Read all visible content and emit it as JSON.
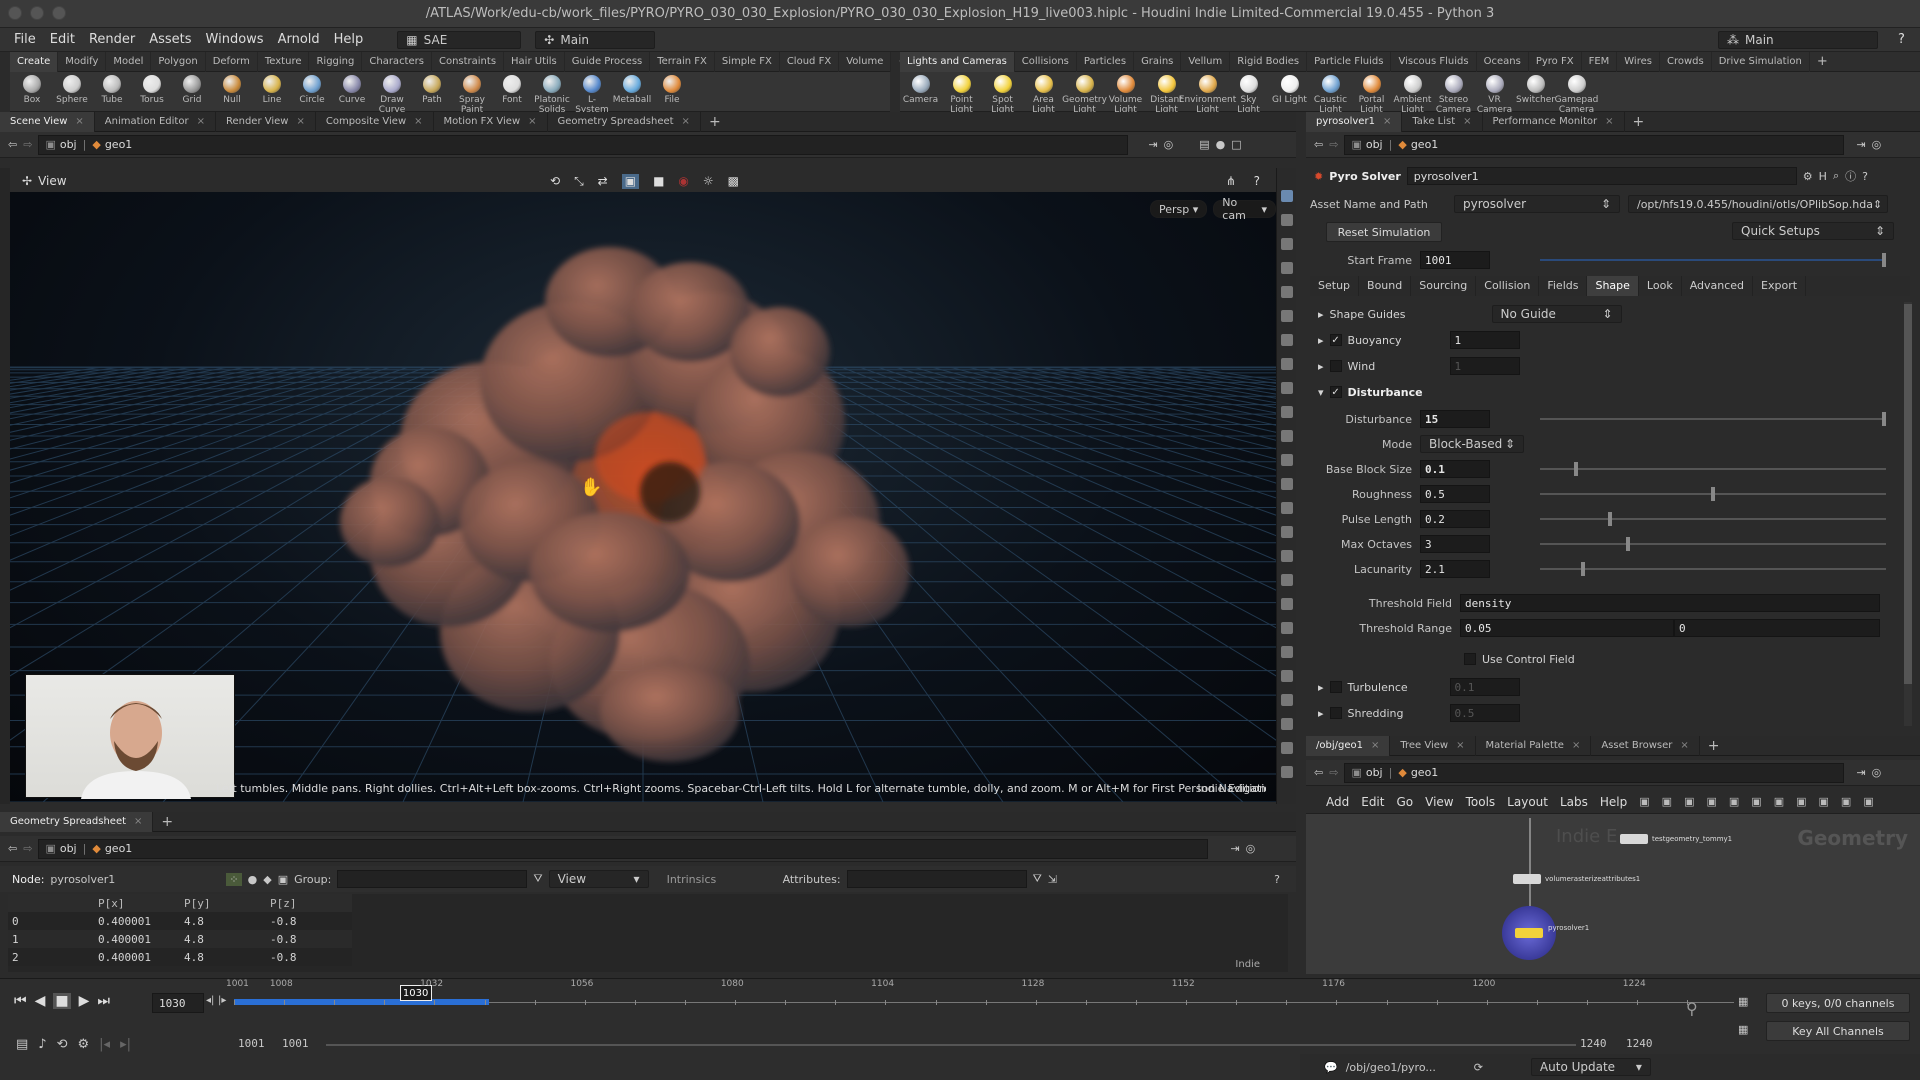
{
  "window": {
    "title": "/ATLAS/Work/edu-cb/work_files/PYRO/PYRO_030_030_Explosion/PYRO_030_030_Explosion_H19_live003.hiplc - Houdini Indie Limited-Commercial 19.0.455 - Python 3",
    "desktop_left": "SAE",
    "desktop_mid": "Main",
    "desktop_right": "Main"
  },
  "menu": [
    "File",
    "Edit",
    "Render",
    "Assets",
    "Windows",
    "Arnold",
    "Help"
  ],
  "shelf_left": {
    "tabs": [
      "Create",
      "Modify",
      "Model",
      "Polygon",
      "Deform",
      "Texture",
      "Rigging",
      "Characters",
      "Constraints",
      "Hair Utils",
      "Guide Process",
      "Terrain FX",
      "Simple FX",
      "Cloud FX",
      "Volume"
    ],
    "tools": [
      "Box",
      "Sphere",
      "Tube",
      "Torus",
      "Grid",
      "Null",
      "Line",
      "Circle",
      "Curve",
      "Draw Curve",
      "Path",
      "Spray Paint",
      "Font",
      "Platonic Solids",
      "L-System",
      "Metaball",
      "File"
    ]
  },
  "shelf_right": {
    "tabs": [
      "Lights and Cameras",
      "Collisions",
      "Particles",
      "Grains",
      "Vellum",
      "Rigid Bodies",
      "Particle Fluids",
      "Viscous Fluids",
      "Oceans",
      "Pyro FX",
      "FEM",
      "Wires",
      "Crowds",
      "Drive Simulation"
    ],
    "tools": [
      "Camera",
      "Point Light",
      "Spot Light",
      "Area Light",
      "Geometry Light",
      "Volume Light",
      "Distant Light",
      "Environment Light",
      "Sky Light",
      "GI Light",
      "Caustic Light",
      "Portal Light",
      "Ambient Light",
      "Stereo Camera",
      "VR Camera",
      "Switcher",
      "Gamepad Camera"
    ]
  },
  "left_pane": {
    "tabs": [
      "Scene View",
      "Animation Editor",
      "Render View",
      "Composite View",
      "Motion FX View",
      "Geometry Spreadsheet"
    ],
    "path_obj": "obj",
    "path_geo": "geo1",
    "view_label": "View",
    "persp": "Persp",
    "cam": "No cam",
    "help_text": "Left tumbles. Middle pans. Right dollies. Ctrl+Alt+Left box-zooms. Ctrl+Right zooms. Spacebar-Ctrl-Left tilts. Hold L for alternate tumble, dolly, and zoom.     M or Alt+M for First Person Navigation.",
    "edition": "Indie Edition"
  },
  "spreadsheet": {
    "tab": "Geometry Spreadsheet",
    "path_obj": "obj",
    "path_geo": "geo1",
    "node_label": "Node:",
    "node": "pyrosolver1",
    "group_label": "Group:",
    "view": "View",
    "intrinsics": "Intrinsics",
    "attributes_label": "Attributes:",
    "columns": [
      "",
      "P[x]",
      "P[y]",
      "P[z]"
    ],
    "rows": [
      [
        "0",
        "0.400001",
        "4.8",
        "-0.8"
      ],
      [
        "1",
        "0.400001",
        "4.8",
        "-0.8"
      ],
      [
        "2",
        "0.400001",
        "4.8",
        "-0.8"
      ]
    ],
    "indie": "Indie"
  },
  "params": {
    "tabs": [
      "pyrosolver1",
      "Take List",
      "Performance Monitor"
    ],
    "path_obj": "obj",
    "path_geo": "geo1",
    "node_type": "Pyro Solver",
    "node_name": "pyrosolver1",
    "asset_label": "Asset Name and Path",
    "asset_name": "pyrosolver",
    "asset_path": "/opt/hfs19.0.455/houdini/otls/OPlibSop.hda",
    "reset": "Reset Simulation",
    "quick": "Quick Setups",
    "start_label": "Start Frame",
    "start_value": "1001",
    "subtabs": [
      "Setup",
      "Bound",
      "Sourcing",
      "Collision",
      "Fields",
      "Shape",
      "Look",
      "Advanced",
      "Export"
    ],
    "shape_guides_label": "Shape Guides",
    "shape_guides_value": "No Guide",
    "buoyancy_label": "Buoyancy",
    "buoyancy_value": "1",
    "wind_label": "Wind",
    "wind_value": "1",
    "disturbance_section": "Disturbance",
    "rows": [
      {
        "label": "Disturbance",
        "value": "15",
        "level": 1.0
      },
      {
        "label": "Mode",
        "value": "Block-Based"
      },
      {
        "label": "Base Block Size",
        "value": "0.1",
        "level": 0.1
      },
      {
        "label": "Roughness",
        "value": "0.5",
        "level": 0.5
      },
      {
        "label": "Pulse Length",
        "value": "0.2",
        "level": 0.2
      },
      {
        "label": "Max Octaves",
        "value": "3",
        "level": 0.25
      },
      {
        "label": "Lacunarity",
        "value": "2.1",
        "level": 0.12
      }
    ],
    "threshold_field_label": "Threshold Field",
    "threshold_field_value": "density",
    "threshold_range_label": "Threshold Range",
    "threshold_range_a": "0.05",
    "threshold_range_b": "0",
    "use_control": "Use Control Field",
    "turbulence": "Turbulence",
    "turbulence_value": "0.1",
    "shredding": "Shredding",
    "shredding_value": "0.5"
  },
  "network": {
    "tabs": [
      "/obj/geo1",
      "Tree View",
      "Material Palette",
      "Asset Browser"
    ],
    "path_obj": "obj",
    "path_geo": "geo1",
    "menu": [
      "Add",
      "Edit",
      "Go",
      "View",
      "Tools",
      "Layout",
      "Labs",
      "Help"
    ],
    "watermark_left": "Indie E",
    "watermark_right": "Geometry",
    "nodes": [
      "testgeometry_tommy1",
      "volumerasterizeattributes1",
      "pyrosolver1"
    ]
  },
  "timeline": {
    "current": "1030",
    "ticks": [
      "1001",
      "1008",
      "1032",
      "1056",
      "1080",
      "1104",
      "1128",
      "1152",
      "1176",
      "1200",
      "1224"
    ],
    "range_start_a": "1001",
    "range_start_b": "1001",
    "range_end_a": "1240",
    "range_end_b": "1240",
    "keys": "0 keys, 0/0 channels",
    "key_all": "Key All Channels",
    "cached_fraction": 0.17
  },
  "status": {
    "path": "/obj/geo1/pyro...",
    "update": "Auto Update"
  },
  "colors": {
    "accent_blue": "#2a6fd6",
    "node_green": "#5cbf4a",
    "pyro_red": "#d84a2c"
  }
}
